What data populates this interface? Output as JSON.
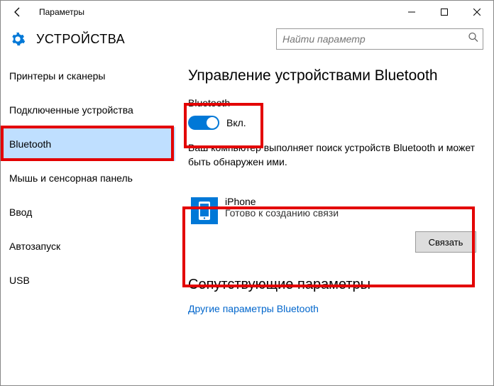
{
  "titlebar": {
    "title": "Параметры"
  },
  "header": {
    "page": "УСТРОЙСТВА"
  },
  "search": {
    "placeholder": "Найти параметр"
  },
  "sidebar": {
    "items": [
      {
        "label": "Принтеры и сканеры"
      },
      {
        "label": "Подключенные устройства"
      },
      {
        "label": "Bluetooth"
      },
      {
        "label": "Мышь и сенсорная панель"
      },
      {
        "label": "Ввод"
      },
      {
        "label": "Автозапуск"
      },
      {
        "label": "USB"
      }
    ],
    "selected_index": 2
  },
  "main": {
    "title": "Управление устройствами Bluetooth",
    "bt_label": "Bluetooth",
    "toggle_state": "Вкл.",
    "toggle_on": true,
    "description": "Ваш компьютер выполняет поиск устройств Bluetooth и может быть обнаружен ими.",
    "device": {
      "name": "iPhone",
      "status": "Готово к созданию связи"
    },
    "pair_button": "Связать",
    "related_title": "Сопутствующие параметры",
    "related_link": "Другие параметры Bluetooth"
  }
}
